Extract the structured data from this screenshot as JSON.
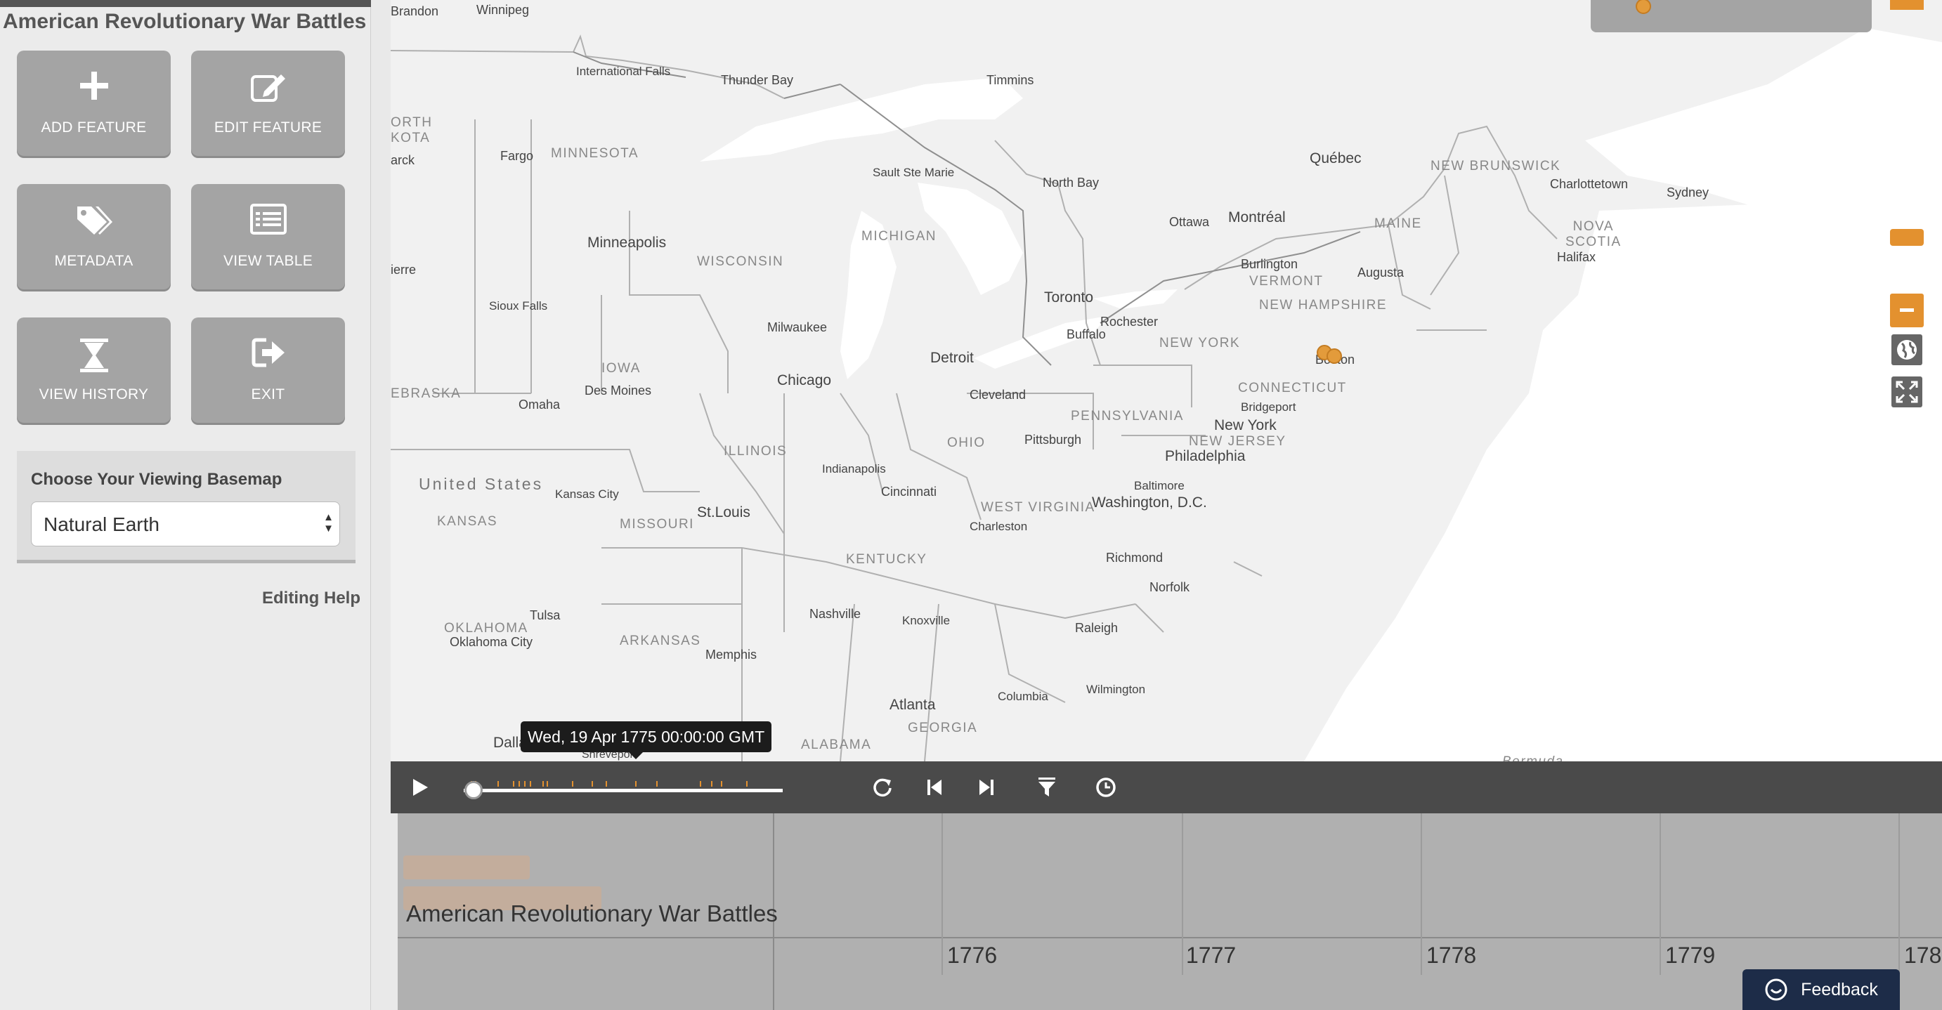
{
  "sidebar": {
    "title": "American Revolutionary War Battles",
    "buttons": [
      {
        "label": "ADD FEATURE",
        "icon": "plus-icon"
      },
      {
        "label": "EDIT FEATURE",
        "icon": "edit-icon"
      },
      {
        "label": "METADATA",
        "icon": "tags-icon"
      },
      {
        "label": "VIEW TABLE",
        "icon": "table-icon"
      },
      {
        "label": "VIEW HISTORY",
        "icon": "hourglass-icon"
      },
      {
        "label": "EXIT",
        "icon": "exit-icon"
      }
    ],
    "basemap": {
      "label": "Choose Your Viewing Basemap",
      "selected": "Natural Earth"
    },
    "help_link": "Editing Help"
  },
  "map": {
    "labels": {
      "brandon": "Brandon",
      "winnipeg": "Winnipeg",
      "intl_falls": "International Falls",
      "thunder_bay": "Thunder Bay",
      "timmins": "Timmins",
      "north_dakota": "ORTH\nKOTA",
      "fargo": "Fargo",
      "minnesota": "MINNESOTA",
      "bismarck": "arck",
      "sault": "Sault Ste Marie",
      "north_bay": "North Bay",
      "quebec": "Québec",
      "new_brunswick": "NEW BRUNSWICK",
      "charlottetown": "Charlottetown",
      "sydney": "Sydney",
      "michigan": "MICHIGAN",
      "minneapolis": "Minneapolis",
      "wisconsin": "WISCONSIN",
      "ottawa": "Ottawa",
      "montreal": "Montréal",
      "maine": "MAINE",
      "nova_scotia": "NOVA\nSCOTIA",
      "halifax": "Halifax",
      "pierre": "ierre",
      "burlington": "Burlington",
      "vermont": "VERMONT",
      "augusta": "Augusta",
      "sioux_falls": "Sioux Falls",
      "toronto": "Toronto",
      "new_hampshire": "NEW HAMPSHIRE",
      "milwaukee": "Milwaukee",
      "rochester": "Rochester",
      "buffalo": "Buffalo",
      "new_york_state": "NEW YORK",
      "iowa": "IOWA",
      "detroit": "Detroit",
      "boston": "Boston",
      "des_moines": "Des Moines",
      "chicago": "Chicago",
      "cleveland": "Cleveland",
      "connecticut": "CONNECTICUT",
      "nebraska": "EBRASKA",
      "omaha": "Omaha",
      "bridgeport": "Bridgeport",
      "pennsylvania": "PENNSYLVANIA",
      "new_york_city": "New York",
      "ohio": "OHIO",
      "pittsburgh": "Pittsburgh",
      "new_jersey": "NEW JERSEY",
      "illinois": "ILLINOIS",
      "philadelphia": "Philadelphia",
      "indianapolis": "Indianapolis",
      "united_states": "United States",
      "kansas_city": "Kansas City",
      "baltimore": "Baltimore",
      "cincinnati": "Cincinnati",
      "st_louis": "St.Louis",
      "west_virginia": "WEST VIRGINIA",
      "washington": "Washington, D.C.",
      "kansas": "KANSAS",
      "missouri": "MISSOURI",
      "charleston": "Charleston",
      "kentucky": "KENTUCKY",
      "richmond": "Richmond",
      "norfolk": "Norfolk",
      "tulsa": "Tulsa",
      "oklahoma": "OKLAHOMA",
      "oklahoma_city": "Oklahoma City",
      "nashville": "Nashville",
      "knoxville": "Knoxville",
      "arkansas": "ARKANSAS",
      "raleigh": "Raleigh",
      "memphis": "Memphis",
      "columbia": "Columbia",
      "wilmington": "Wilmington",
      "atlanta": "Atlanta",
      "georgia": "GEORGIA",
      "alabama": "ALABAMA",
      "dallas": "Dalla",
      "shreveport": "Shreveport",
      "bermuda": "Bermuda"
    },
    "colors": {
      "land": "#f1f1f1",
      "water": "#ffffff",
      "border": "#b0b0b0",
      "marker": "#e39b3b",
      "accent": "#e3912f"
    }
  },
  "tooltip": "Wed, 19 Apr 1775 00:00:00 GMT",
  "time_controls": {
    "icons": [
      "play-icon",
      "reload-icon",
      "step-back-icon",
      "step-forward-icon",
      "filter-icon",
      "clock-icon"
    ],
    "position": 0.03
  },
  "timeline": {
    "group": "American Revolutionary War Battles",
    "years": [
      "1776",
      "1777",
      "1778",
      "1779",
      "178"
    ]
  },
  "feedback": "Feedback"
}
